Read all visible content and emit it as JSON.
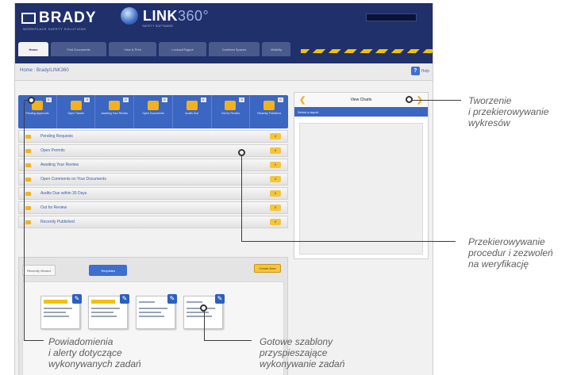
{
  "app": {
    "brand": "BRADY",
    "brand_tagline": "WORKPLACE SAFETY SOLUTIONS",
    "product": "LINK",
    "product_suffix": "360°",
    "product_sub": "SAFETY SOFTWARE"
  },
  "nav": {
    "tabs": [
      "Home",
      "Find Documents",
      "View & Print",
      "Lockout/Tagout",
      "Confined Spaces",
      "Visibility"
    ],
    "active_tab": 0
  },
  "subbar": {
    "breadcrumb": "Home : Brady/LINK360",
    "help_label": "Help"
  },
  "quick_icons": [
    {
      "caption": "Pending Approvals",
      "count": "0"
    },
    {
      "caption": "Open Tickets",
      "count": "0"
    },
    {
      "caption": "Awaiting Your Review",
      "count": "0"
    },
    {
      "caption": "Open Documents",
      "count": "0"
    },
    {
      "caption": "Audits Due",
      "count": "0"
    },
    {
      "caption": "Out for Review",
      "count": "0"
    },
    {
      "caption": "Recently Published",
      "count": "0"
    }
  ],
  "list_items": [
    {
      "label": "Pending Requests",
      "count": "0"
    },
    {
      "label": "Open Permits",
      "count": "0"
    },
    {
      "label": "Awaiting Your Review",
      "count": "0"
    },
    {
      "label": "Open Comments on Your Documents",
      "count": "0"
    },
    {
      "label": "Audits Due within 30 Days",
      "count": "0"
    },
    {
      "label": "Out for Review",
      "count": "0"
    },
    {
      "label": "Recently Published",
      "count": "0"
    }
  ],
  "templates_panel": {
    "recently_viewed_label": "Recently Viewed",
    "templates_label": "Templates",
    "create_new_label": "Create New",
    "thumbnails": [
      "template-1",
      "template-2",
      "template-3",
      "template-4"
    ]
  },
  "charts_panel": {
    "title": "View Charts",
    "header_bar": "Select a report"
  },
  "callouts": {
    "charts": [
      "Tworzenie",
      "i przekierowywanie",
      "wykresów"
    ],
    "procedures": [
      "Przekierowywanie",
      "procedur i zezwoleń",
      "na weryfikację"
    ],
    "notifications": [
      "Powiadomienia",
      "i alerty dotyczące",
      "wykonywanych zadań"
    ],
    "templates": [
      "Gotowe szablony",
      "przyspieszające",
      "wykonywanie zadań"
    ]
  },
  "colors": {
    "header": "#20306b",
    "accent_blue": "#3b66c2",
    "accent_yellow": "#f2b21d"
  }
}
